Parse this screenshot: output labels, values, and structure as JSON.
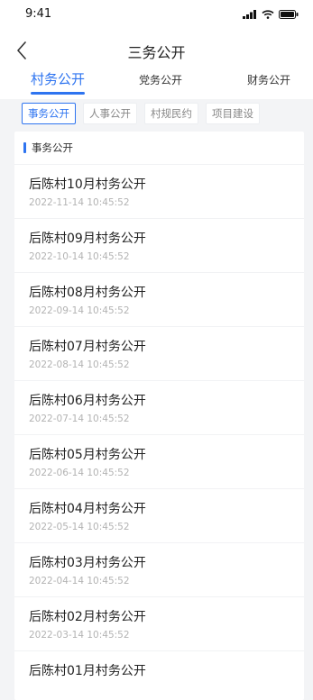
{
  "status_bar": {
    "time": "9:41"
  },
  "nav": {
    "title": "三务公开"
  },
  "main_tabs": [
    {
      "label": "村务公开",
      "active": true
    },
    {
      "label": "党务公开",
      "active": false
    },
    {
      "label": "财务公开",
      "active": false
    }
  ],
  "sub_tabs": [
    {
      "label": "事务公开",
      "active": true
    },
    {
      "label": "人事公开",
      "active": false
    },
    {
      "label": "村规民约",
      "active": false
    },
    {
      "label": "项目建设",
      "active": false
    }
  ],
  "section": {
    "title": "事务公开"
  },
  "items": [
    {
      "title": "后陈村10月村务公开",
      "time": "2022-11-14 10:45:52"
    },
    {
      "title": "后陈村09月村务公开",
      "time": "2022-10-14 10:45:52"
    },
    {
      "title": "后陈村08月村务公开",
      "time": "2022-09-14 10:45:52"
    },
    {
      "title": "后陈村07月村务公开",
      "time": "2022-08-14 10:45:52"
    },
    {
      "title": "后陈村06月村务公开",
      "time": "2022-07-14 10:45:52"
    },
    {
      "title": "后陈村05月村务公开",
      "time": "2022-06-14 10:45:52"
    },
    {
      "title": "后陈村04月村务公开",
      "time": "2022-05-14 10:45:52"
    },
    {
      "title": "后陈村03月村务公开",
      "time": "2022-04-14 10:45:52"
    },
    {
      "title": "后陈村02月村务公开",
      "time": "2022-03-14 10:45:52"
    },
    {
      "title": "后陈村01月村务公开",
      "time": ""
    }
  ],
  "colors": {
    "accent": "#2e74f0",
    "background": "#f3f4f6",
    "muted_text": "#b3b3b3"
  }
}
